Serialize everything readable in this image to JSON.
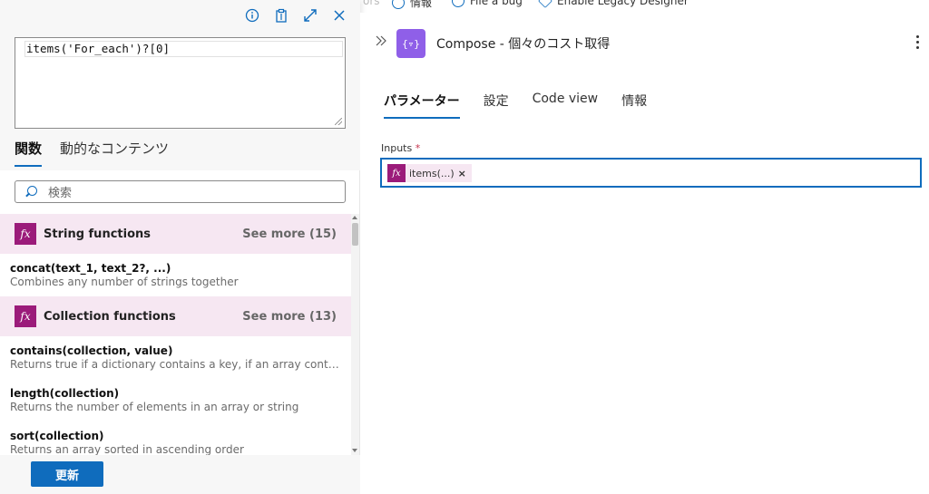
{
  "top_toolbar": {
    "faint_label": "ors",
    "info_label": "情報",
    "bug_label": "File a bug",
    "legacy_label": "Enable Legacy Designer"
  },
  "expression_editor": {
    "value": "items('For_each')?[0]"
  },
  "left_tabs": [
    {
      "label": "関数",
      "active": true
    },
    {
      "label": "動的なコンテンツ",
      "active": false
    }
  ],
  "search": {
    "placeholder": "検索"
  },
  "function_groups": [
    {
      "icon": "fx-icon",
      "title": "String functions",
      "more": "See more (15)"
    },
    {
      "icon": "fx-icon",
      "title": "Collection functions",
      "more": "See more (13)"
    }
  ],
  "string_functions": [
    {
      "signature": "concat(text_1, text_2?, ...)",
      "description": "Combines any number of strings together"
    }
  ],
  "collection_functions": [
    {
      "signature": "contains(collection, value)",
      "description": "Returns true if a dictionary contains a key, if an array contains a value, or if a string contains a substring"
    },
    {
      "signature": "length(collection)",
      "description": "Returns the number of elements in an array or string"
    },
    {
      "signature": "sort(collection)",
      "description": "Returns an array sorted in ascending order"
    }
  ],
  "footer": {
    "update_label": "更新"
  },
  "action": {
    "icon_text": "{▿}",
    "title": "Compose - 個々のコスト取得"
  },
  "right_tabs": [
    {
      "label": "パラメーター",
      "active": true
    },
    {
      "label": "設定",
      "active": false
    },
    {
      "label": "Code view",
      "active": false
    },
    {
      "label": "情報",
      "active": false
    }
  ],
  "inputs": {
    "label": "Inputs",
    "required_mark": "*",
    "token_label": "items(...)",
    "token_remove": "×"
  },
  "colors": {
    "accent": "#0f6cbd",
    "fx_badge": "#9b1b7a",
    "group_bg": "#f6e7f2",
    "action_icon": "#8f5fe8"
  }
}
